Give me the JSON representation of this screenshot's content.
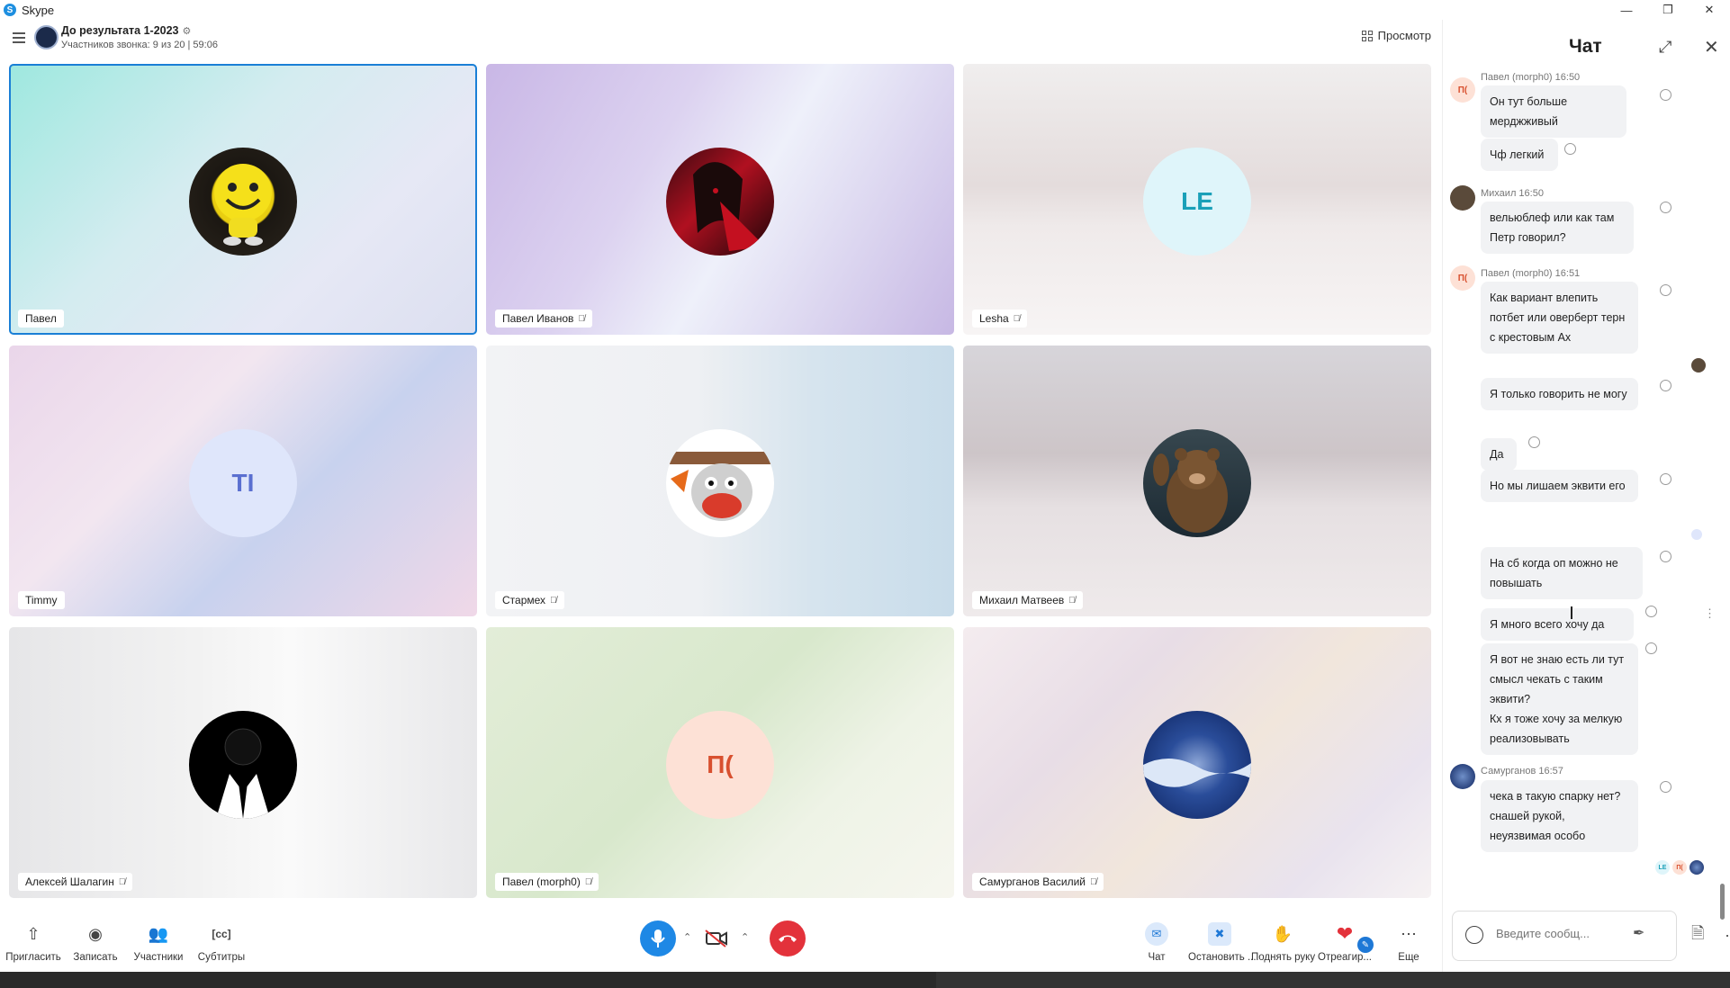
{
  "window": {
    "title": "Skype"
  },
  "header": {
    "group_name": "До результата 1-2023",
    "group_settings_icon": "gear-icon",
    "subtitle": "Участников звонка: 9 из 20 | 59:06",
    "view_label": "Просмотр"
  },
  "participants": [
    {
      "name": "Павел",
      "initials": "",
      "muted": false,
      "active": true
    },
    {
      "name": "Павел Иванов",
      "initials": "",
      "muted": true
    },
    {
      "name": "Lesha",
      "initials": "LE",
      "muted": true
    },
    {
      "name": "Timmy",
      "initials": "TI",
      "muted": false
    },
    {
      "name": "Стармех",
      "initials": "",
      "muted": true
    },
    {
      "name": "Михаил Матвеев",
      "initials": "",
      "muted": true
    },
    {
      "name": "Алексей Шалагин",
      "initials": "",
      "muted": true
    },
    {
      "name": "Павел (morph0)",
      "initials": "П(",
      "muted": true
    },
    {
      "name": "Самурганов Василий",
      "initials": "",
      "muted": true
    }
  ],
  "controls": {
    "invite": "Пригласить",
    "record": "Записать",
    "participants": "Участники",
    "subtitles": "Субтитры",
    "chat": "Чат",
    "stop": "Остановить ...",
    "raise_hand": "Поднять руку",
    "react": "Отреагир...",
    "more": "Еще"
  },
  "chat": {
    "title": "Чат",
    "messages": [
      {
        "sender": "Павел (morph0) 16:50",
        "initials": "П(",
        "lines": [
          "Он тут больше мерджживый"
        ]
      },
      {
        "sender": "",
        "lines": [
          "Чф легкий"
        ]
      },
      {
        "sender": "Михаил 16:50",
        "lines": [
          "вельюблеф или как там Петр говорил?"
        ]
      },
      {
        "sender": "Павел (morph0) 16:51",
        "initials": "П(",
        "lines": [
          "Как вариант влепить потбет или оверберт терн с крестовым Ах"
        ]
      },
      {
        "sender": "",
        "lines": [
          "Я только говорить не могу"
        ]
      },
      {
        "sender": "",
        "lines": [
          "Да"
        ]
      },
      {
        "sender": "",
        "lines": [
          "Но мы лишаем эквити его"
        ]
      },
      {
        "sender": "",
        "lines": [
          "На сб когда оп можно не повышать"
        ]
      },
      {
        "sender": "",
        "lines": [
          "Я много всего хочу да"
        ]
      },
      {
        "sender": "",
        "lines": [
          "Я вот не знаю есть ли тут смысл чекать с таким эквити?",
          "Кх я тоже хочу за мелкую реализовывать"
        ]
      },
      {
        "sender": "Самурганов 16:57",
        "lines": [
          "чека в такую спарку нет? снашей рукой, неуязвимая особо"
        ]
      }
    ],
    "read_receipts": [
      "LE",
      "П(",
      ""
    ],
    "input_placeholder": "Введите сообщ..."
  },
  "colors": {
    "accent": "#1a7fd6",
    "end_call": "#e3323b",
    "mic": "#1e88e5"
  }
}
